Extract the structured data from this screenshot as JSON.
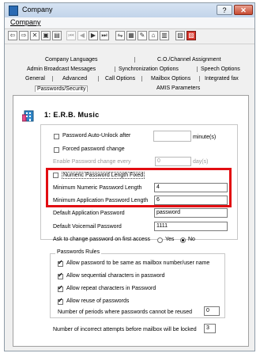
{
  "window": {
    "title": "Company",
    "help_label": "?",
    "close_label": "✕"
  },
  "menu": {
    "company": "Company"
  },
  "toolbar": {
    "first": "⏮",
    "prev": "◀",
    "next": "▶",
    "last": "⏭",
    "tool_a": "⇦",
    "tool_b": "⇨",
    "tool_c": "✕",
    "tool_d": "▣",
    "tool_e": "▤",
    "tool_f": "⇋",
    "tool_g": "▦",
    "tool_h": "✎",
    "tool_i": "⌂",
    "tool_j": "▥",
    "tool_k": "▧",
    "tool_l": "▨"
  },
  "tabs": {
    "row1": [
      "Company Languages",
      "C.O./Channel Assignment"
    ],
    "row2": [
      "Admin Broadcast Messages",
      "Synchronization Options",
      "Speech Options"
    ],
    "row3": [
      "General",
      "Advanced",
      "Call Options",
      "Mailbox Options",
      "Integrated fax"
    ],
    "row4": [
      "Passwords/Security",
      "AMIS Parameters"
    ]
  },
  "header": {
    "label": "1: E.R.B. Music"
  },
  "form": {
    "auto_unlock_label": "Password Auto-Unlock after",
    "auto_unlock_value": "",
    "auto_unlock_unit": "minute(s)",
    "forced_change_label": "Forced password change",
    "enable_change_label": "Enable Password change every",
    "enable_change_value": "0",
    "enable_change_unit": "day(s)",
    "numeric_fixed_label": "Numeric Password Length Fixed",
    "min_numeric_label": "Minimum Numeric Password Length",
    "min_numeric_value": "4",
    "min_app_label": "Minimum Application Password Length",
    "min_app_value": "6",
    "default_app_label": "Default Application Password",
    "default_app_value": "password",
    "default_vm_label": "Default Voicemail Password",
    "default_vm_value": "1111",
    "ask_change_label": "Ask to change password on first access",
    "ask_yes": "Yes",
    "ask_no": "No"
  },
  "rules": {
    "title": "Passwords Rules",
    "same_as_mailbox": "Allow password to be same as mailbox number/user name",
    "sequential": "Allow sequential characters in password",
    "repeat": "Allow repeat characters in Password",
    "reuse": "Allow reuse of passwords",
    "periods_label": "Number of periods where passwords cannot be reused",
    "periods_value": "0"
  },
  "incorrect": {
    "label": "Number of incorrect attempts before mailbox will be locked",
    "value": "3"
  }
}
